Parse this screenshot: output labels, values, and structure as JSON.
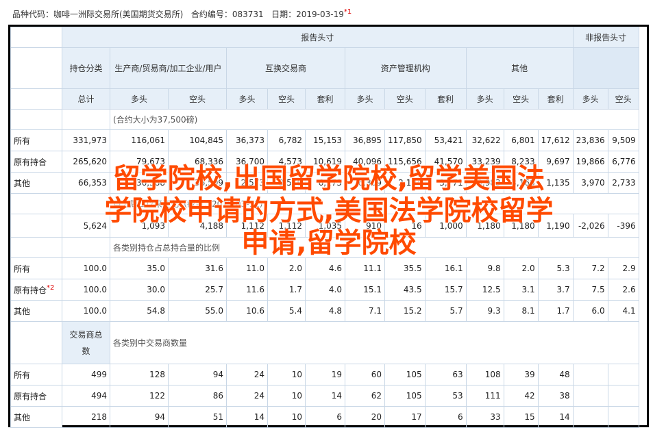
{
  "header": {
    "market": "品种代码：咖啡一洲际交易所(美国期货交易所)",
    "contract": "合约编号：083731",
    "date": "日期：2019-03-19",
    "date_note": "*1"
  },
  "table": {
    "reportable": "报告头寸",
    "nonreportable": "非报告头寸",
    "position_class": "持仓分类",
    "group_producer": "生产商/贸易商/加工企业/用户",
    "group_swap": "互换交易商",
    "group_managed": "资产管理机构",
    "group_other": "其他",
    "total": "总计",
    "long": "多头",
    "short": "空头",
    "spread": "套利",
    "contract_size_note": "(合约大小为37,500磅)",
    "changes_note": "自上周二以来变化（截至：2019-03-12）",
    "pct_note": "各类别持仓占总持合量的比例",
    "traders_label": "交易商总数",
    "traders_note": "各类别中交易商数量",
    "rows_positions": [
      {
        "label": "所有",
        "sup": "",
        "values": [
          "331,973",
          "116,061",
          "104,845",
          "36,373",
          "6,782",
          "15,153",
          "36,895",
          "117,850",
          "53,421",
          "32,622",
          "6,801",
          "17,612",
          "23,836",
          "9,509"
        ]
      },
      {
        "label": "原有持合",
        "sup": "",
        "values": [
          "265,620",
          "79,673",
          "68,336",
          "36,700",
          "4,573",
          "10,619",
          "40,096",
          "115,656",
          "41,570",
          "33,239",
          "8,233",
          "9,697",
          "19,866",
          "6,776"
        ]
      },
      {
        "label": "其他",
        "sup": "",
        "values": [
          "66,353",
          "36,388",
          "36,509",
          "2,573",
          "3,576",
          "6,173",
          "6,309",
          "2,194",
          "3,771",
          "3,983",
          "3,168",
          "1,135",
          "3,970",
          "2,733"
        ]
      }
    ],
    "row_change": {
      "label": "",
      "values": [
        "5,624",
        "1,093",
        "4,188",
        "1,112",
        "1,112",
        "1,035",
        "910",
        "16",
        "1,000",
        "1,180",
        "1,180",
        "1,190",
        "-2,026",
        "-396"
      ]
    },
    "rows_pct": [
      {
        "label": "所有",
        "sup": "",
        "values": [
          "100.0",
          "35.0",
          "31.6",
          "11.0",
          "2.0",
          "4.6",
          "11.1",
          "35.5",
          "16.1",
          "9.8",
          "2.0",
          "5.3",
          "7.2",
          "2.9"
        ]
      },
      {
        "label": "原有持仓",
        "sup": "*2",
        "values": [
          "100.0",
          "30.0",
          "25.7",
          "11.6",
          "1.7",
          "4.0",
          "15.1",
          "43.5",
          "15.7",
          "12.5",
          "3.1",
          "3.7",
          "7.5",
          "2.6"
        ]
      },
      {
        "label": "其他",
        "sup": "",
        "values": [
          "100.0",
          "54.8",
          "55.0",
          "10.6",
          "5.4",
          "4.8",
          "7.1",
          "15.2",
          "5.7",
          "9.3",
          "8.1",
          "1.7",
          "6.0",
          "4.1"
        ]
      }
    ],
    "rows_traders": [
      {
        "label": "所有",
        "values": [
          "499",
          "128",
          "94",
          "24",
          "10",
          "19",
          "60",
          "105",
          "63",
          "108",
          "39",
          "48",
          "",
          ""
        ]
      },
      {
        "label": "原有持合",
        "values": [
          "494",
          "122",
          "86",
          "24",
          "10",
          "14",
          "62",
          "105",
          "53",
          "111",
          "42",
          "38",
          "",
          ""
        ]
      },
      {
        "label": "其他",
        "values": [
          "218",
          "94",
          "51",
          "14",
          "10",
          "6",
          "20",
          "17",
          "6",
          "33",
          "15",
          "14",
          "",
          ""
        ]
      }
    ]
  },
  "overlay": {
    "line1": "留学院校,出国留学院校,留学美国法",
    "line2": "学院校申请的方式,美国法学院校留学",
    "line3": "申请,留学院校"
  },
  "colors": {
    "overlay_text": "#ff4a00",
    "header_bg": "#e6eff8",
    "grid": "#c9d7e6",
    "note_red": "#dd0000"
  }
}
